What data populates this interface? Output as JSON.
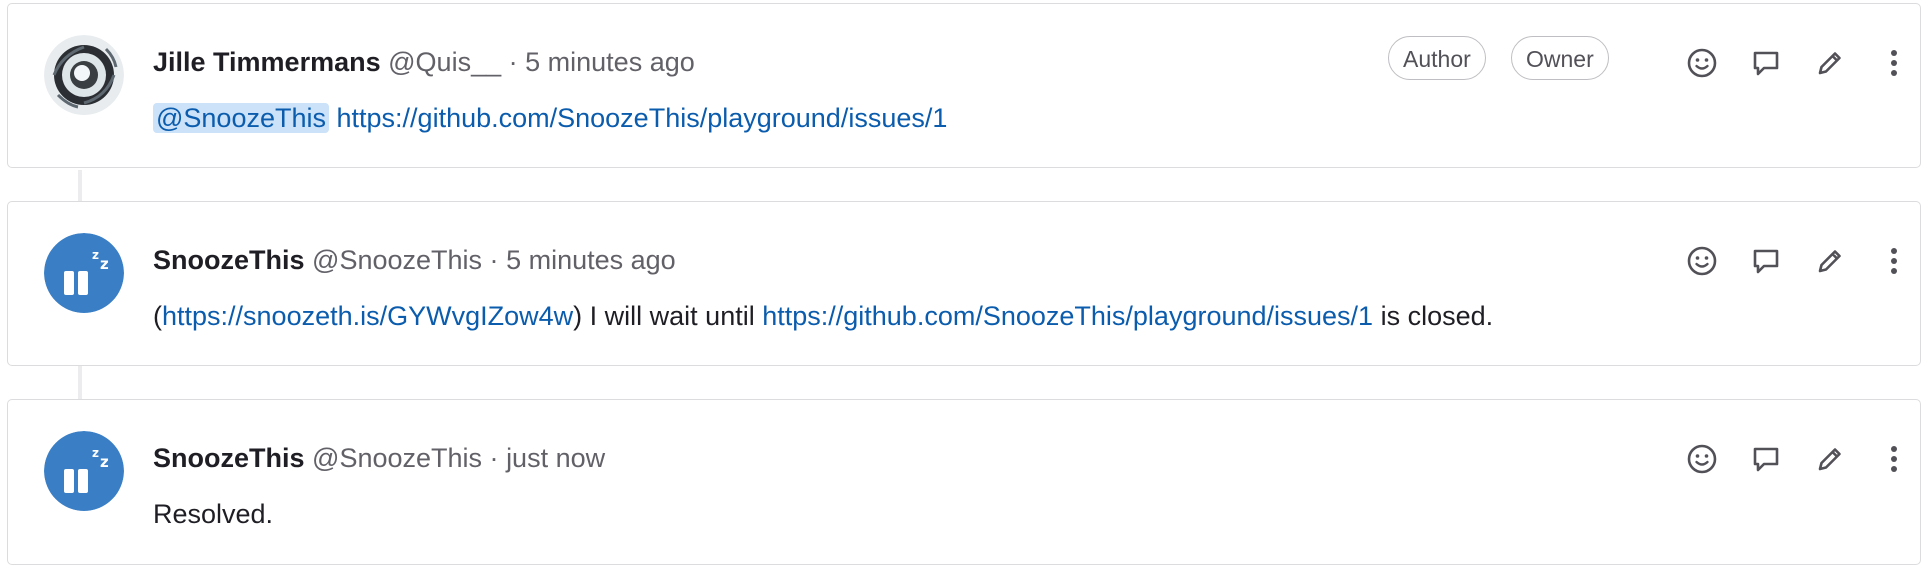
{
  "notes": [
    {
      "author_name": "Jille Timmermans",
      "author_handle": "@Quis__",
      "separator": "·",
      "time": "5 minutes ago",
      "badges": [
        "Author",
        "Owner"
      ],
      "avatar": "generic-avatar",
      "body": {
        "mention": "@SnoozeThis",
        "link": "https://github.com/SnoozeThis/playground/issues/1"
      }
    },
    {
      "author_name": "SnoozeThis",
      "author_handle": "@SnoozeThis",
      "separator": "·",
      "time": "5 minutes ago",
      "avatar": "snooze-bot-avatar",
      "body": {
        "open_paren": "(",
        "link1": "https://snoozeth.is/GYWvgIZow4w",
        "text1": ") I will wait until ",
        "link2": "https://github.com/SnoozeThis/playground/issues/1",
        "text2": " is closed."
      }
    },
    {
      "author_name": "SnoozeThis",
      "author_handle": "@SnoozeThis",
      "separator": "·",
      "time": "just now",
      "avatar": "snooze-bot-avatar",
      "body": {
        "text": "Resolved."
      }
    }
  ],
  "icons": {
    "emoji": "smiley-icon",
    "reply": "speech-bubble-icon",
    "edit": "pencil-icon",
    "more": "kebab-menu-icon"
  },
  "colors": {
    "link": "#0b5cad",
    "mention_bg": "#cbe2f9",
    "avatar_blue": "#3a7fc6"
  }
}
